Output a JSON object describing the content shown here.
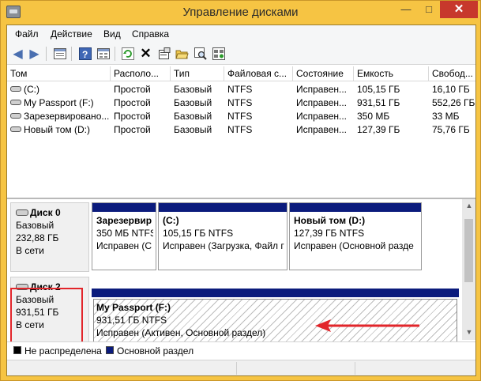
{
  "window": {
    "title": "Управление дисками"
  },
  "menu": {
    "items": [
      "Файл",
      "Действие",
      "Вид",
      "Справка"
    ]
  },
  "table": {
    "columns": [
      "Том",
      "Располо...",
      "Тип",
      "Файловая с...",
      "Состояние",
      "Емкость",
      "Свобод..."
    ],
    "rows": [
      [
        "(C:)",
        "Простой",
        "Базовый",
        "NTFS",
        "Исправен...",
        "105,15 ГБ",
        "16,10 ГБ"
      ],
      [
        "My Passport (F:)",
        "Простой",
        "Базовый",
        "NTFS",
        "Исправен...",
        "931,51 ГБ",
        "552,26 ГБ"
      ],
      [
        "Зарезервировано...",
        "Простой",
        "Базовый",
        "NTFS",
        "Исправен...",
        "350 МБ",
        "33 МБ"
      ],
      [
        "Новый том (D:)",
        "Простой",
        "Базовый",
        "NTFS",
        "Исправен...",
        "127,39 ГБ",
        "75,76 ГБ"
      ]
    ]
  },
  "disks": [
    {
      "name": "Диск 0",
      "type": "Базовый",
      "size": "232,88 ГБ",
      "status": "В сети",
      "partitions": [
        {
          "name": "Зарезервир",
          "size": "350 МБ NTFS",
          "status": "Исправен (С"
        },
        {
          "name": "(C:)",
          "size": "105,15 ГБ NTFS",
          "status": "Исправен (Загрузка, Файл г"
        },
        {
          "name": "Новый том  (D:)",
          "size": "127,39 ГБ NTFS",
          "status": "Исправен (Основной разде"
        }
      ]
    },
    {
      "name": "Диск 2",
      "type": "Базовый",
      "size": "931,51 ГБ",
      "status": "В сети",
      "partitions": [
        {
          "name": "My Passport  (F:)",
          "size": "931,51 ГБ NTFS",
          "status": "Исправен (Активен, Основной раздел)"
        }
      ]
    }
  ],
  "legend": {
    "unallocated": "Не распределена",
    "primary": "Основной раздел"
  },
  "colors": {
    "primary_partition": "#0b1b7c",
    "unallocated": "#000000",
    "highlight": "#e2252a",
    "title_bar": "#f6c443"
  }
}
